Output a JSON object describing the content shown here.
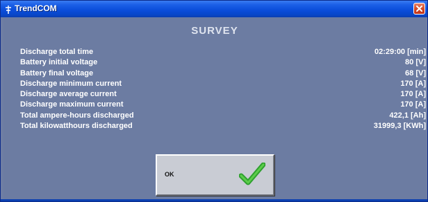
{
  "window": {
    "title": "TrendCOM",
    "icon": "app-icon",
    "close_icon": "close-icon"
  },
  "survey": {
    "heading": "SURVEY",
    "rows": [
      {
        "label": "Discharge total time",
        "value": "02:29:00 [min]"
      },
      {
        "label": "Battery initial voltage",
        "value": "80 [V]"
      },
      {
        "label": "Battery final voltage",
        "value": "68 [V]"
      },
      {
        "label": "Discharge minimum current",
        "value": "170 [A]"
      },
      {
        "label": "Discharge average current",
        "value": "170 [A]"
      },
      {
        "label": "Discharge maximum current",
        "value": "170 [A]"
      },
      {
        "label": "Total ampere-hours discharged",
        "value": "422,1 [Ah]"
      },
      {
        "label": "Total kilowatthours discharged",
        "value": "31999,3 [KWh]"
      }
    ]
  },
  "ok_button": {
    "label": "OK",
    "icon": "checkmark-icon"
  },
  "colors": {
    "titlebar": "#0a4cd9",
    "panel": "#6c7ca2",
    "text": "#ffffff",
    "checkmark": "#2fa02f",
    "close": "#d24a26"
  }
}
